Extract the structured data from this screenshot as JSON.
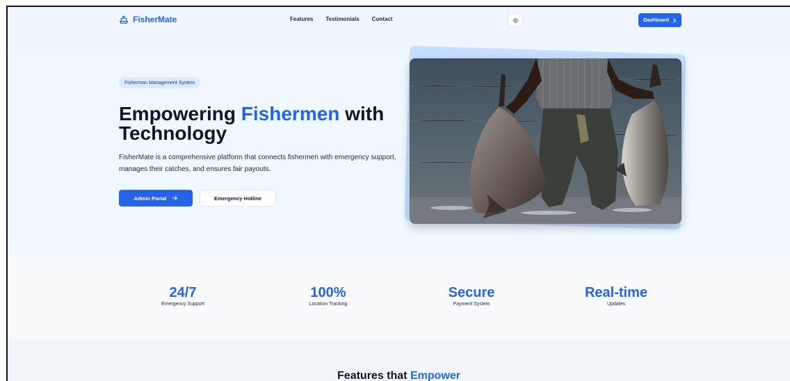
{
  "nav": {
    "brand": "FisherMate",
    "links": [
      "Features",
      "Testimonials",
      "Contact"
    ],
    "theme_icon": "sun-icon",
    "dashboard_label": "Dashboard",
    "dashboard_icon": "chevron-right-icon"
  },
  "hero": {
    "badge": "Fisherman Management System",
    "headline_part1": "Empowering ",
    "headline_accent": "Fishermen",
    "headline_part2": " with Technology",
    "description": "FisherMate is a comprehensive platform that connects fishermen with emergency support, manages their catches, and ensures fair payouts.",
    "primary_button": "Admin Portal",
    "primary_icon": "arrow-right-icon",
    "secondary_button": "Emergency Hotline",
    "image_subject": "fisherman-with-catch-photo"
  },
  "stats": [
    {
      "value": "24/7",
      "label": "Emergency Support"
    },
    {
      "value": "100%",
      "label": "Location Tracking"
    },
    {
      "value": "Secure",
      "label": "Payment System"
    },
    {
      "value": "Real-time",
      "label": "Updates"
    }
  ],
  "features": {
    "title_part1": "Features that ",
    "title_accent": "Empower"
  },
  "colors": {
    "accent": "#2563eb",
    "text": "#0f172a",
    "badge_bg": "#dbeafe"
  }
}
